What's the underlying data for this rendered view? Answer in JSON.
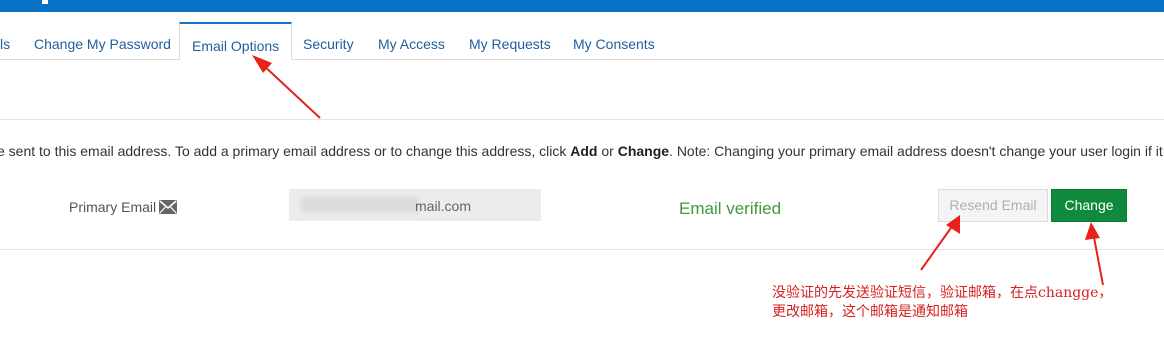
{
  "tabs": [
    {
      "label": "ls"
    },
    {
      "label": "Change My Password"
    },
    {
      "label": "Email Options",
      "active": true
    },
    {
      "label": "Security"
    },
    {
      "label": "My Access"
    },
    {
      "label": "My Requests"
    },
    {
      "label": "My Consents"
    }
  ],
  "description": {
    "part1": "e sent to this email address. To add a primary email address or to change this address, click ",
    "add": "Add",
    "or": " or ",
    "change": "Change",
    "part2": ". Note: Changing your primary email address doesn't change your user login if it is"
  },
  "email_row": {
    "label": "Primary Email",
    "icon": "envelope-icon",
    "value_visible": "mail.com",
    "status": "Email verified",
    "resend_label": "Resend Email",
    "change_label": "Change"
  },
  "annotation": {
    "line1": "没验证的先发送验证短信，验证邮箱，在点changge，",
    "line2": "更改邮箱，这个邮箱是通知邮箱",
    "color": "#d61f1f"
  },
  "colors": {
    "topbar": "#0a72c4",
    "tab_text": "#1f5f9e",
    "verified": "#3f9a3a",
    "change_button": "#0f8a3c"
  }
}
